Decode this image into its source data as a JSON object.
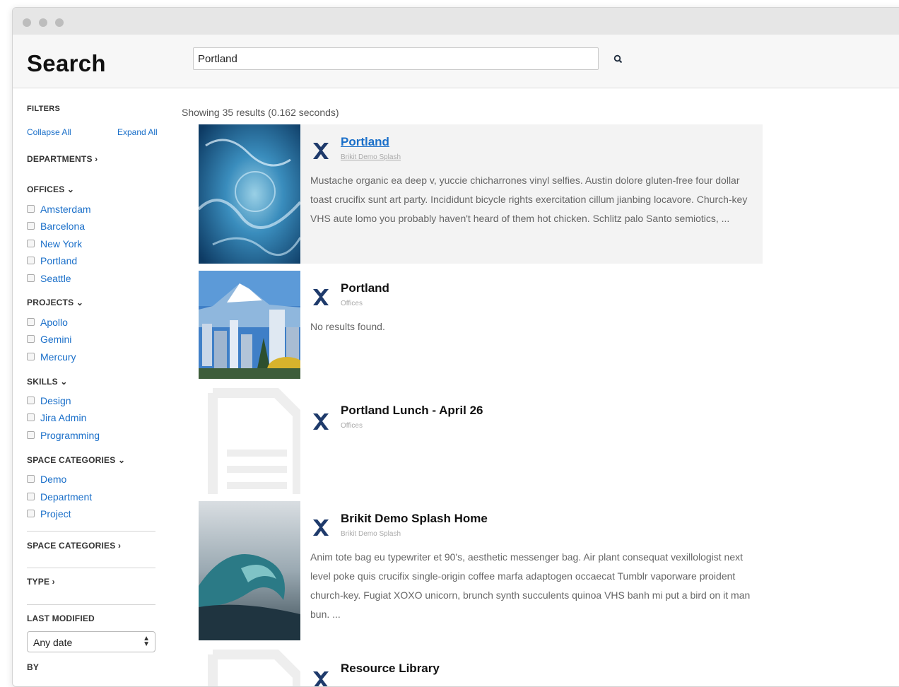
{
  "window": {
    "dots": [
      "close",
      "minimize",
      "zoom"
    ]
  },
  "header": {
    "title": "Search",
    "search_value": "Portland",
    "search_icon": "search-icon"
  },
  "sidebar": {
    "filters_label": "FILTERS",
    "collapse_all": "Collapse All",
    "expand_all": "Expand All",
    "departments": "DEPARTMENTS ›",
    "offices": {
      "label": "OFFICES ⌄",
      "items": [
        "Amsterdam",
        "Barcelona",
        "New York",
        "Portland",
        "Seattle"
      ]
    },
    "projects": {
      "label": "PROJECTS ⌄",
      "items": [
        "Apollo",
        "Gemini",
        "Mercury"
      ]
    },
    "skills": {
      "label": "SKILLS ⌄",
      "items": [
        "Design",
        "Jira Admin",
        "Programming"
      ]
    },
    "space_categories_open": {
      "label": "SPACE CATEGORIES ⌄",
      "items": [
        "Demo",
        "Department",
        "Project"
      ]
    },
    "space_categories_closed": "SPACE CATEGORIES ›",
    "type": "TYPE ›",
    "last_modified": "LAST MODIFIED",
    "last_modified_value": "Any date",
    "by": "BY"
  },
  "results": {
    "summary": "Showing 35 results (0.162 seconds)",
    "items": [
      {
        "title": "Portland",
        "space": "Brikit Demo Splash",
        "description": "Mustache organic ea deep v, yuccie chicharrones vinyl selfies. Austin dolore gluten-free four dollar toast crucifix sunt art party. Incididunt bicycle rights exercitation cillum jianbing locavore. Church-key VHS aute lomo you probably haven't heard of them hot chicken. Schlitz palo Santo semiotics, ...",
        "thumb": "ocean-water-image"
      },
      {
        "title": "Portland",
        "space": "Offices",
        "description": "No results found.",
        "thumb": "mount-hood-city-image"
      },
      {
        "title": "Portland Lunch - April 26",
        "space": "Offices",
        "description": "",
        "thumb": "document-placeholder-icon"
      },
      {
        "title": "Brikit Demo Splash Home",
        "space": "Brikit Demo Splash",
        "description": "Anim tote bag eu typewriter et 90's, aesthetic messenger bag. Air plant consequat vexillologist next level poke quis crucifix single-origin coffee marfa adaptogen occaecat Tumblr vaporware proident church-key. Fugiat XOXO unicorn, brunch synth succulents quinoa VHS banh mi put a bird on it man bun. ...",
        "thumb": "wave-image"
      },
      {
        "title": "Resource Library",
        "space": "",
        "description": "",
        "thumb": "document-placeholder-icon"
      }
    ]
  },
  "colors": {
    "link": "#1a6fc9",
    "logo": "#1e3a6b",
    "highlight": "#f3f3f3"
  }
}
